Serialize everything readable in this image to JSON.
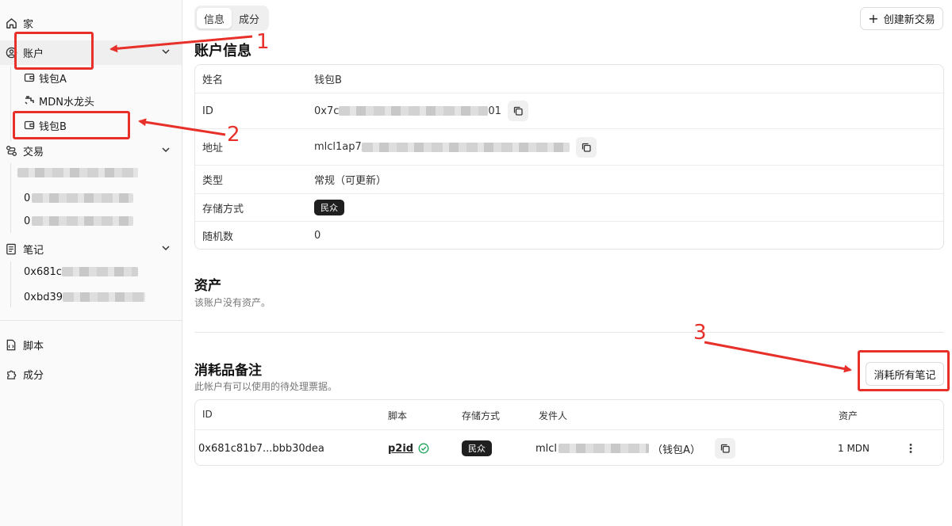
{
  "sidebar": {
    "home": "家",
    "accounts": "账户",
    "wallet_a": "钱包A",
    "faucet": "MDN水龙头",
    "wallet_b": "钱包B",
    "transactions": "交易",
    "tx_item_2_prefix": "0",
    "tx_item_3_prefix": "0",
    "notes": "笔记",
    "note_1": "0x681c",
    "note_2": "0xbd39",
    "scripts": "脚本",
    "components": "成分"
  },
  "tabs": [
    "信息",
    "成分"
  ],
  "create_button": "创建新交易",
  "account_info": {
    "title": "账户信息",
    "rows": [
      {
        "key": "姓名",
        "value": "钱包B"
      },
      {
        "key": "ID",
        "value_prefix": "0x7c",
        "value_suffix": "01"
      },
      {
        "key": "地址",
        "value_prefix": "mlcl1ap7"
      },
      {
        "key": "类型",
        "value": "常规（可更新）"
      },
      {
        "key": "存储方式",
        "value": "民众"
      },
      {
        "key": "随机数",
        "value": "0"
      }
    ]
  },
  "assets": {
    "title": "资产",
    "empty": "该账户没有资产。"
  },
  "consumable_notes": {
    "title": "消耗品备注",
    "subtitle": "此帐户有可以使用的待处理票据。",
    "consume_all": "消耗所有笔记",
    "columns": [
      "ID",
      "脚本",
      "存储方式",
      "发件人",
      "资产"
    ],
    "rows": [
      {
        "id": "0x681c81b7...bbb30dea",
        "script": "p2id",
        "storage": "民众",
        "sender_prefix": "mlcl",
        "sender_name": "（钱包A）",
        "asset": "1 MDN"
      }
    ]
  },
  "annotations": [
    "1",
    "2",
    "3"
  ],
  "colors": {
    "annotation": "#e8302a",
    "badge": "#1f1f1f",
    "check": "#22a35a"
  }
}
